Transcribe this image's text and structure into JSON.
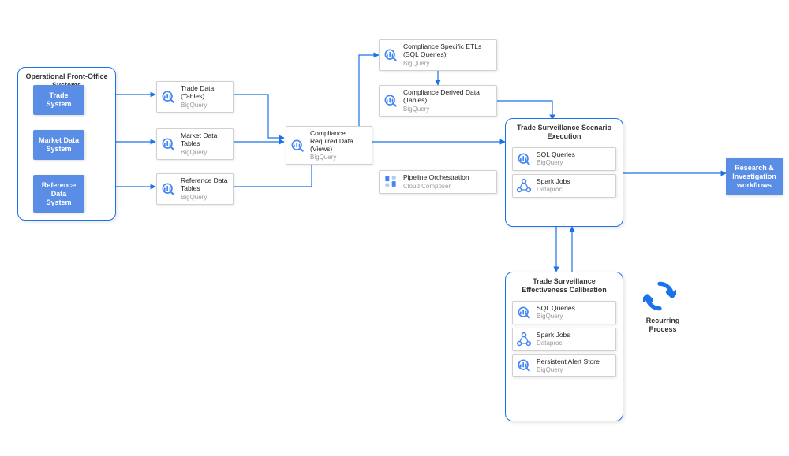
{
  "groups": {
    "front_office": {
      "title": "Operational Front-Office Systems",
      "items": [
        "Trade System",
        "Market Data System",
        "Reference Data System"
      ]
    },
    "scenario": {
      "title": "Trade Surveillance Scenario Execution",
      "cards": [
        {
          "title": "SQL Queries",
          "sub": "BigQuery",
          "icon": "bq"
        },
        {
          "title": "Spark Jobs",
          "sub": "Dataproc",
          "icon": "dp"
        }
      ]
    },
    "calibration": {
      "title": "Trade Surveillance Effectiveness Calibration",
      "cards": [
        {
          "title": "SQL Queries",
          "sub": "BigQuery",
          "icon": "bq"
        },
        {
          "title": "Spark Jobs",
          "sub": "Dataproc",
          "icon": "dp"
        },
        {
          "title": "Persistent Alert Store",
          "sub": "BigQuery",
          "icon": "bq"
        }
      ]
    }
  },
  "cards": {
    "trade_data": {
      "title": "Trade Data (Tables)",
      "sub": "BigQuery"
    },
    "market_data": {
      "title": "Market Data Tables",
      "sub": "BigQuery"
    },
    "reference_data": {
      "title": "Reference Data Tables",
      "sub": "BigQuery"
    },
    "compliance_views": {
      "title": "Compliance Required Data (Views)",
      "sub": "BigQuery"
    },
    "etl": {
      "title": "Compliance Specific ETLs (SQL Queries)",
      "sub": "BigQuery"
    },
    "derived": {
      "title": "Compliance Derived Data (Tables)",
      "sub": "BigQuery"
    },
    "orchestration": {
      "title": "Pipeline Orchestration",
      "sub": "Cloud Composer"
    }
  },
  "output_box": "Research & Investigation workflows",
  "recurring_label": "Recurring Process",
  "colors": {
    "accent": "#1a73e8",
    "source": "#5a8ee6"
  }
}
